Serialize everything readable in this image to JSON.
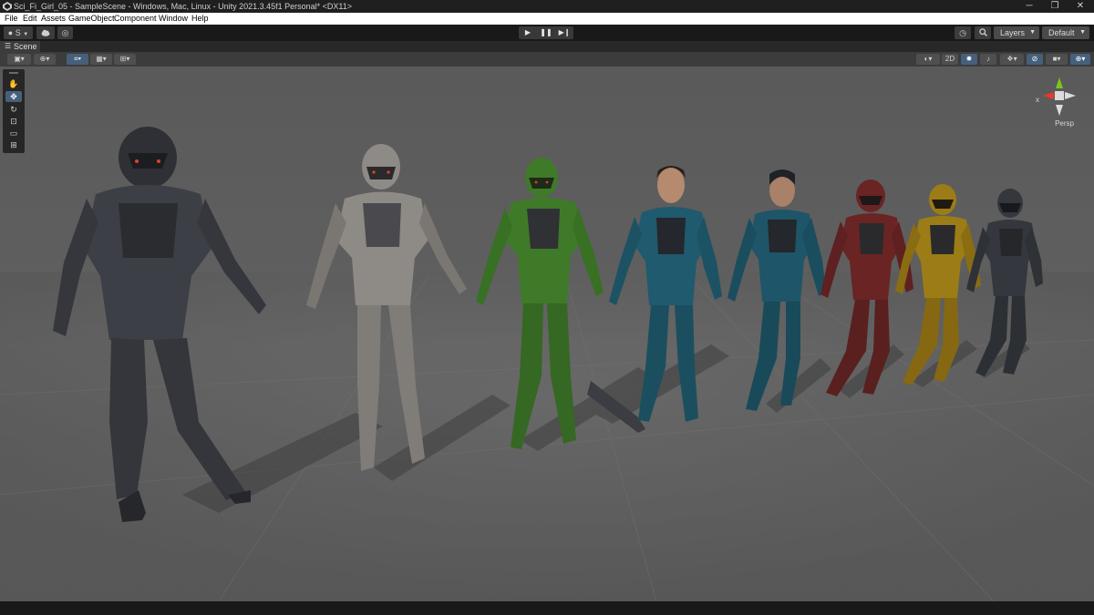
{
  "window": {
    "title": "Sci_Fi_Girl_05 - SampleScene - Windows, Mac, Linux - Unity 2021.3.45f1 Personal* <DX11>",
    "minimize": "─",
    "maximize": "❐",
    "close": "✕"
  },
  "menu": [
    "File",
    "Edit",
    "Assets",
    "GameObject",
    "Component",
    "Window",
    "Help"
  ],
  "toolbar": {
    "account_label": "S",
    "layers_label": "Layers",
    "layout_label": "Default"
  },
  "scene_tab": {
    "label": "Scene"
  },
  "scene_toolbar": {
    "mode_2d": "2D"
  },
  "gizmo": {
    "axis_x": "x",
    "persp_label": "Persp"
  },
  "colors": {
    "accent": "#46607c",
    "gizmo_x": "#e8382a",
    "gizmo_y": "#7ac61c",
    "gizmo_z": "#3a7ff0"
  },
  "icons": [
    "unity-logo-icon",
    "account-icon",
    "cloud-icon",
    "collab-icon",
    "play-icon",
    "pause-icon",
    "step-icon",
    "history-icon",
    "search-icon",
    "hand-tool-icon",
    "move-tool-icon",
    "rotate-tool-icon",
    "scale-tool-icon",
    "rect-tool-icon",
    "transform-tool-icon"
  ],
  "scene_contents": [
    {
      "name": "armor-dark",
      "color": "#3c3f45"
    },
    {
      "name": "armor-white",
      "color": "#8e8a86"
    },
    {
      "name": "armor-green",
      "color": "#3f7a28"
    },
    {
      "name": "armor-teal",
      "color": "#1f5a6e"
    },
    {
      "name": "armor-teal-2",
      "color": "#1e5568"
    },
    {
      "name": "armor-red",
      "color": "#6a2424"
    },
    {
      "name": "armor-yellow",
      "color": "#9c7c16"
    },
    {
      "name": "armor-dark-2",
      "color": "#34373d"
    }
  ]
}
